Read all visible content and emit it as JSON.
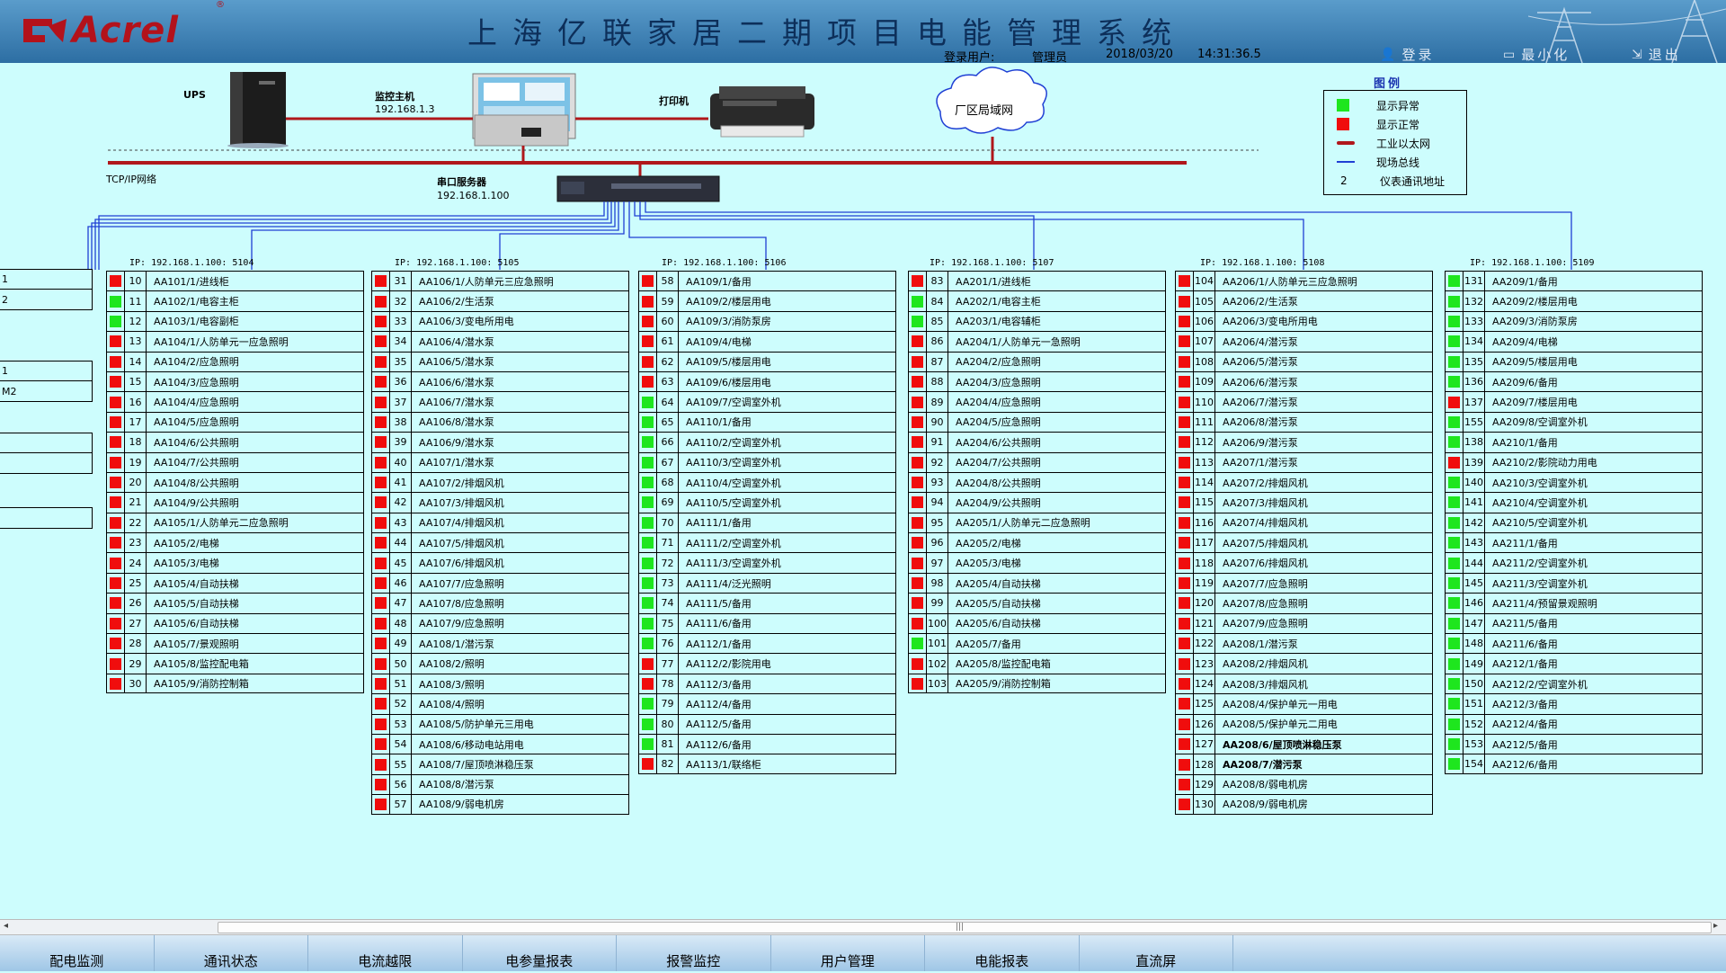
{
  "header": {
    "logo_text": "Acrel",
    "logo_reg": "®",
    "title": "上海亿联家居二期项目电能管理系统",
    "user_label": "登录用户:",
    "user_name": "管理员",
    "date": "2018/03/20",
    "time": "14:31:36.5",
    "login_label": "登录",
    "minimize_label": "最小化",
    "exit_label": "退出"
  },
  "network": {
    "ups_label": "UPS",
    "host_label": "监控主机",
    "host_ip": "192.168.1.3",
    "printer_label": "打印机",
    "lan_label": "厂区局域网",
    "tcpip_label": "TCP/IP网络",
    "serial_label": "串口服务器",
    "serial_ip": "192.168.1.100"
  },
  "legend": {
    "title": "图例",
    "items": [
      {
        "symbol": "green-square",
        "text": "显示异常"
      },
      {
        "symbol": "red-square",
        "text": "显示正常"
      },
      {
        "symbol": "red-line",
        "text": "工业以太网"
      },
      {
        "symbol": "blue-line",
        "text": "现场总线"
      },
      {
        "symbol": "2",
        "text": "仪表通讯地址"
      }
    ]
  },
  "partial_panel": {
    "groups": [
      [
        "1",
        "2"
      ],
      [
        "1",
        "M2"
      ],
      [
        "",
        ""
      ],
      [
        ""
      ]
    ]
  },
  "panels": [
    {
      "ip": "IP: 192.168.1.100: 5104",
      "rows": [
        {
          "n": "10",
          "label": "AA101/1/进线柜",
          "status": "red"
        },
        {
          "n": "11",
          "label": "AA102/1/电容主柜",
          "status": "green"
        },
        {
          "n": "12",
          "label": "AA103/1/电容副柜",
          "status": "green"
        },
        {
          "n": "13",
          "label": "AA104/1/人防单元一应急照明",
          "status": "red"
        },
        {
          "n": "14",
          "label": "AA104/2/应急照明",
          "status": "red"
        },
        {
          "n": "15",
          "label": "AA104/3/应急照明",
          "status": "red"
        },
        {
          "n": "16",
          "label": "AA104/4/应急照明",
          "status": "red"
        },
        {
          "n": "17",
          "label": "AA104/5/应急照明",
          "status": "red"
        },
        {
          "n": "18",
          "label": "AA104/6/公共照明",
          "status": "red"
        },
        {
          "n": "19",
          "label": "AA104/7/公共照明",
          "status": "red"
        },
        {
          "n": "20",
          "label": "AA104/8/公共照明",
          "status": "red"
        },
        {
          "n": "21",
          "label": "AA104/9/公共照明",
          "status": "red"
        },
        {
          "n": "22",
          "label": "AA105/1/人防单元二应急照明",
          "status": "red"
        },
        {
          "n": "23",
          "label": "AA105/2/电梯",
          "status": "red"
        },
        {
          "n": "24",
          "label": "AA105/3/电梯",
          "status": "red"
        },
        {
          "n": "25",
          "label": "AA105/4/自动扶梯",
          "status": "red"
        },
        {
          "n": "26",
          "label": "AA105/5/自动扶梯",
          "status": "red"
        },
        {
          "n": "27",
          "label": "AA105/6/自动扶梯",
          "status": "red"
        },
        {
          "n": "28",
          "label": "AA105/7/景观照明",
          "status": "red"
        },
        {
          "n": "29",
          "label": "AA105/8/监控配电箱",
          "status": "red"
        },
        {
          "n": "30",
          "label": "AA105/9/消防控制箱",
          "status": "red"
        }
      ]
    },
    {
      "ip": "IP: 192.168.1.100: 5105",
      "rows": [
        {
          "n": "31",
          "label": "AA106/1/人防单元三应急照明",
          "status": "red"
        },
        {
          "n": "32",
          "label": "AA106/2/生活泵",
          "status": "red"
        },
        {
          "n": "33",
          "label": "AA106/3/变电所用电",
          "status": "red"
        },
        {
          "n": "34",
          "label": "AA106/4/潜水泵",
          "status": "red"
        },
        {
          "n": "35",
          "label": "AA106/5/潜水泵",
          "status": "red"
        },
        {
          "n": "36",
          "label": "AA106/6/潜水泵",
          "status": "red"
        },
        {
          "n": "37",
          "label": "AA106/7/潜水泵",
          "status": "red"
        },
        {
          "n": "38",
          "label": "AA106/8/潜水泵",
          "status": "red"
        },
        {
          "n": "39",
          "label": "AA106/9/潜水泵",
          "status": "red"
        },
        {
          "n": "40",
          "label": "AA107/1/潜水泵",
          "status": "red"
        },
        {
          "n": "41",
          "label": "AA107/2/排烟风机",
          "status": "red"
        },
        {
          "n": "42",
          "label": "AA107/3/排烟风机",
          "status": "red"
        },
        {
          "n": "43",
          "label": "AA107/4/排烟风机",
          "status": "red"
        },
        {
          "n": "44",
          "label": "AA107/5/排烟风机",
          "status": "red"
        },
        {
          "n": "45",
          "label": "AA107/6/排烟风机",
          "status": "red"
        },
        {
          "n": "46",
          "label": "AA107/7/应急照明",
          "status": "red"
        },
        {
          "n": "47",
          "label": "AA107/8/应急照明",
          "status": "red"
        },
        {
          "n": "48",
          "label": "AA107/9/应急照明",
          "status": "red"
        },
        {
          "n": "49",
          "label": "AA108/1/潜污泵",
          "status": "red"
        },
        {
          "n": "50",
          "label": "AA108/2/照明",
          "status": "red"
        },
        {
          "n": "51",
          "label": "AA108/3/照明",
          "status": "red"
        },
        {
          "n": "52",
          "label": "AA108/4/照明",
          "status": "red"
        },
        {
          "n": "53",
          "label": "AA108/5/防护单元三用电",
          "status": "red"
        },
        {
          "n": "54",
          "label": "AA108/6/移动电站用电",
          "status": "red"
        },
        {
          "n": "55",
          "label": "AA108/7/屋顶喷淋稳压泵",
          "status": "red"
        },
        {
          "n": "56",
          "label": "AA108/8/潜污泵",
          "status": "red"
        },
        {
          "n": "57",
          "label": "AA108/9/弱电机房",
          "status": "red"
        }
      ]
    },
    {
      "ip": "IP: 192.168.1.100: 5106",
      "rows": [
        {
          "n": "58",
          "label": "AA109/1/备用",
          "status": "red"
        },
        {
          "n": "59",
          "label": "AA109/2/楼层用电",
          "status": "red"
        },
        {
          "n": "60",
          "label": "AA109/3/消防泵房",
          "status": "red"
        },
        {
          "n": "61",
          "label": "AA109/4/电梯",
          "status": "red"
        },
        {
          "n": "62",
          "label": "AA109/5/楼层用电",
          "status": "red"
        },
        {
          "n": "63",
          "label": "AA109/6/楼层用电",
          "status": "red"
        },
        {
          "n": "64",
          "label": "AA109/7/空调室外机",
          "status": "green"
        },
        {
          "n": "65",
          "label": "AA110/1/备用",
          "status": "green"
        },
        {
          "n": "66",
          "label": "AA110/2/空调室外机",
          "status": "green"
        },
        {
          "n": "67",
          "label": "AA110/3/空调室外机",
          "status": "green"
        },
        {
          "n": "68",
          "label": "AA110/4/空调室外机",
          "status": "green"
        },
        {
          "n": "69",
          "label": "AA110/5/空调室外机",
          "status": "green"
        },
        {
          "n": "70",
          "label": "AA111/1/备用",
          "status": "green"
        },
        {
          "n": "71",
          "label": "AA111/2/空调室外机",
          "status": "green"
        },
        {
          "n": "72",
          "label": "AA111/3/空调室外机",
          "status": "green"
        },
        {
          "n": "73",
          "label": "AA111/4/泛光照明",
          "status": "green"
        },
        {
          "n": "74",
          "label": "AA111/5/备用",
          "status": "green"
        },
        {
          "n": "75",
          "label": "AA111/6/备用",
          "status": "green"
        },
        {
          "n": "76",
          "label": "AA112/1/备用",
          "status": "green"
        },
        {
          "n": "77",
          "label": "AA112/2/影院用电",
          "status": "red"
        },
        {
          "n": "78",
          "label": "AA112/3/备用",
          "status": "red"
        },
        {
          "n": "79",
          "label": "AA112/4/备用",
          "status": "green"
        },
        {
          "n": "80",
          "label": "AA112/5/备用",
          "status": "green"
        },
        {
          "n": "81",
          "label": "AA112/6/备用",
          "status": "green"
        },
        {
          "n": "82",
          "label": "AA113/1/联络柜",
          "status": "red"
        }
      ]
    },
    {
      "ip": "IP: 192.168.1.100: 5107",
      "rows": [
        {
          "n": "83",
          "label": "AA201/1/进线柜",
          "status": "red"
        },
        {
          "n": "84",
          "label": "AA202/1/电容主柜",
          "status": "green"
        },
        {
          "n": "85",
          "label": "AA203/1/电容辅柜",
          "status": "green"
        },
        {
          "n": "86",
          "label": "AA204/1/人防单元一急照明",
          "status": "red"
        },
        {
          "n": "87",
          "label": "AA204/2/应急照明",
          "status": "red"
        },
        {
          "n": "88",
          "label": "AA204/3/应急照明",
          "status": "red"
        },
        {
          "n": "89",
          "label": "AA204/4/应急照明",
          "status": "red"
        },
        {
          "n": "90",
          "label": "AA204/5/应急照明",
          "status": "red"
        },
        {
          "n": "91",
          "label": "AA204/6/公共照明",
          "status": "red"
        },
        {
          "n": "92",
          "label": "AA204/7/公共照明",
          "status": "red"
        },
        {
          "n": "93",
          "label": "AA204/8/公共照明",
          "status": "red"
        },
        {
          "n": "94",
          "label": "AA204/9/公共照明",
          "status": "red"
        },
        {
          "n": "95",
          "label": "AA205/1/人防单元二应急照明",
          "status": "red"
        },
        {
          "n": "96",
          "label": "AA205/2/电梯",
          "status": "red"
        },
        {
          "n": "97",
          "label": "AA205/3/电梯",
          "status": "red"
        },
        {
          "n": "98",
          "label": "AA205/4/自动扶梯",
          "status": "red"
        },
        {
          "n": "99",
          "label": "AA205/5/自动扶梯",
          "status": "red"
        },
        {
          "n": "100",
          "label": "AA205/6/自动扶梯",
          "status": "red"
        },
        {
          "n": "101",
          "label": "AA205/7/备用",
          "status": "green"
        },
        {
          "n": "102",
          "label": "AA205/8/监控配电箱",
          "status": "red"
        },
        {
          "n": "103",
          "label": "AA205/9/消防控制箱",
          "status": "red"
        }
      ]
    },
    {
      "ip": "IP: 192.168.1.100: 5108",
      "rows": [
        {
          "n": "104",
          "label": "AA206/1/人防单元三应急照明",
          "status": "red"
        },
        {
          "n": "105",
          "label": "AA206/2/生活泵",
          "status": "red"
        },
        {
          "n": "106",
          "label": "AA206/3/变电所用电",
          "status": "red"
        },
        {
          "n": "107",
          "label": "AA206/4/潜污泵",
          "status": "red"
        },
        {
          "n": "108",
          "label": "AA206/5/潜污泵",
          "status": "red"
        },
        {
          "n": "109",
          "label": "AA206/6/潜污泵",
          "status": "red"
        },
        {
          "n": "110",
          "label": "AA206/7/潜污泵",
          "status": "red"
        },
        {
          "n": "111",
          "label": "AA206/8/潜污泵",
          "status": "red"
        },
        {
          "n": "112",
          "label": "AA206/9/潜污泵",
          "status": "red"
        },
        {
          "n": "113",
          "label": "AA207/1/潜污泵",
          "status": "red"
        },
        {
          "n": "114",
          "label": "AA207/2/排烟风机",
          "status": "red"
        },
        {
          "n": "115",
          "label": "AA207/3/排烟风机",
          "status": "red"
        },
        {
          "n": "116",
          "label": "AA207/4/排烟风机",
          "status": "red"
        },
        {
          "n": "117",
          "label": "AA207/5/排烟风机",
          "status": "red"
        },
        {
          "n": "118",
          "label": "AA207/6/排烟风机",
          "status": "red"
        },
        {
          "n": "119",
          "label": "AA207/7/应急照明",
          "status": "red"
        },
        {
          "n": "120",
          "label": "AA207/8/应急照明",
          "status": "red"
        },
        {
          "n": "121",
          "label": "AA207/9/应急照明",
          "status": "red"
        },
        {
          "n": "122",
          "label": "AA208/1/潜污泵",
          "status": "red"
        },
        {
          "n": "123",
          "label": "AA208/2/排烟风机",
          "status": "red"
        },
        {
          "n": "124",
          "label": "AA208/3/排烟风机",
          "status": "red"
        },
        {
          "n": "125",
          "label": "AA208/4/保护单元一用电",
          "status": "red"
        },
        {
          "n": "126",
          "label": "AA208/5/保护单元二用电",
          "status": "red"
        },
        {
          "n": "127",
          "label": "AA208/6/屋顶喷淋稳压泵",
          "status": "red",
          "bold": true
        },
        {
          "n": "128",
          "label": "AA208/7/潜污泵",
          "status": "red",
          "bold": true
        },
        {
          "n": "129",
          "label": "AA208/8/弱电机房",
          "status": "red"
        },
        {
          "n": "130",
          "label": "AA208/9/弱电机房",
          "status": "red"
        }
      ]
    },
    {
      "ip": "IP: 192.168.1.100: 5109",
      "rows": [
        {
          "n": "131",
          "label": "AA209/1/备用",
          "status": "green"
        },
        {
          "n": "132",
          "label": "AA209/2/楼层用电",
          "status": "green"
        },
        {
          "n": "133",
          "label": "AA209/3/消防泵房",
          "status": "green"
        },
        {
          "n": "134",
          "label": "AA209/4/电梯",
          "status": "green"
        },
        {
          "n": "135",
          "label": "AA209/5/楼层用电",
          "status": "green"
        },
        {
          "n": "136",
          "label": "AA209/6/备用",
          "status": "green"
        },
        {
          "n": "137",
          "label": "AA209/7/楼层用电",
          "status": "red"
        },
        {
          "n": "155",
          "label": "AA209/8/空调室外机",
          "status": "green"
        },
        {
          "n": "138",
          "label": "AA210/1/备用",
          "status": "green"
        },
        {
          "n": "139",
          "label": "AA210/2/影院动力用电",
          "status": "red"
        },
        {
          "n": "140",
          "label": "AA210/3/空调室外机",
          "status": "green"
        },
        {
          "n": "141",
          "label": "AA210/4/空调室外机",
          "status": "green"
        },
        {
          "n": "142",
          "label": "AA210/5/空调室外机",
          "status": "green"
        },
        {
          "n": "143",
          "label": "AA211/1/备用",
          "status": "green"
        },
        {
          "n": "144",
          "label": "AA211/2/空调室外机",
          "status": "green"
        },
        {
          "n": "145",
          "label": "AA211/3/空调室外机",
          "status": "green"
        },
        {
          "n": "146",
          "label": "AA211/4/预留景观照明",
          "status": "green"
        },
        {
          "n": "147",
          "label": "AA211/5/备用",
          "status": "green"
        },
        {
          "n": "148",
          "label": "AA211/6/备用",
          "status": "green"
        },
        {
          "n": "149",
          "label": "AA212/1/备用",
          "status": "green"
        },
        {
          "n": "150",
          "label": "AA212/2/空调室外机",
          "status": "green"
        },
        {
          "n": "151",
          "label": "AA212/3/备用",
          "status": "green"
        },
        {
          "n": "152",
          "label": "AA212/4/备用",
          "status": "green"
        },
        {
          "n": "153",
          "label": "AA212/5/备用",
          "status": "green"
        },
        {
          "n": "154",
          "label": "AA212/6/备用",
          "status": "green"
        }
      ]
    }
  ],
  "nav": [
    "配电监测",
    "通讯状态",
    "电流越限",
    "电参量报表",
    "报警监控",
    "用户管理",
    "电能报表",
    "直流屏"
  ],
  "colors": {
    "status_green": "#1ee61e",
    "status_red": "#f00d0d",
    "ethernet": "#b0171b",
    "fieldbus": "#1f3fd4",
    "background": "#cdfdfd"
  }
}
